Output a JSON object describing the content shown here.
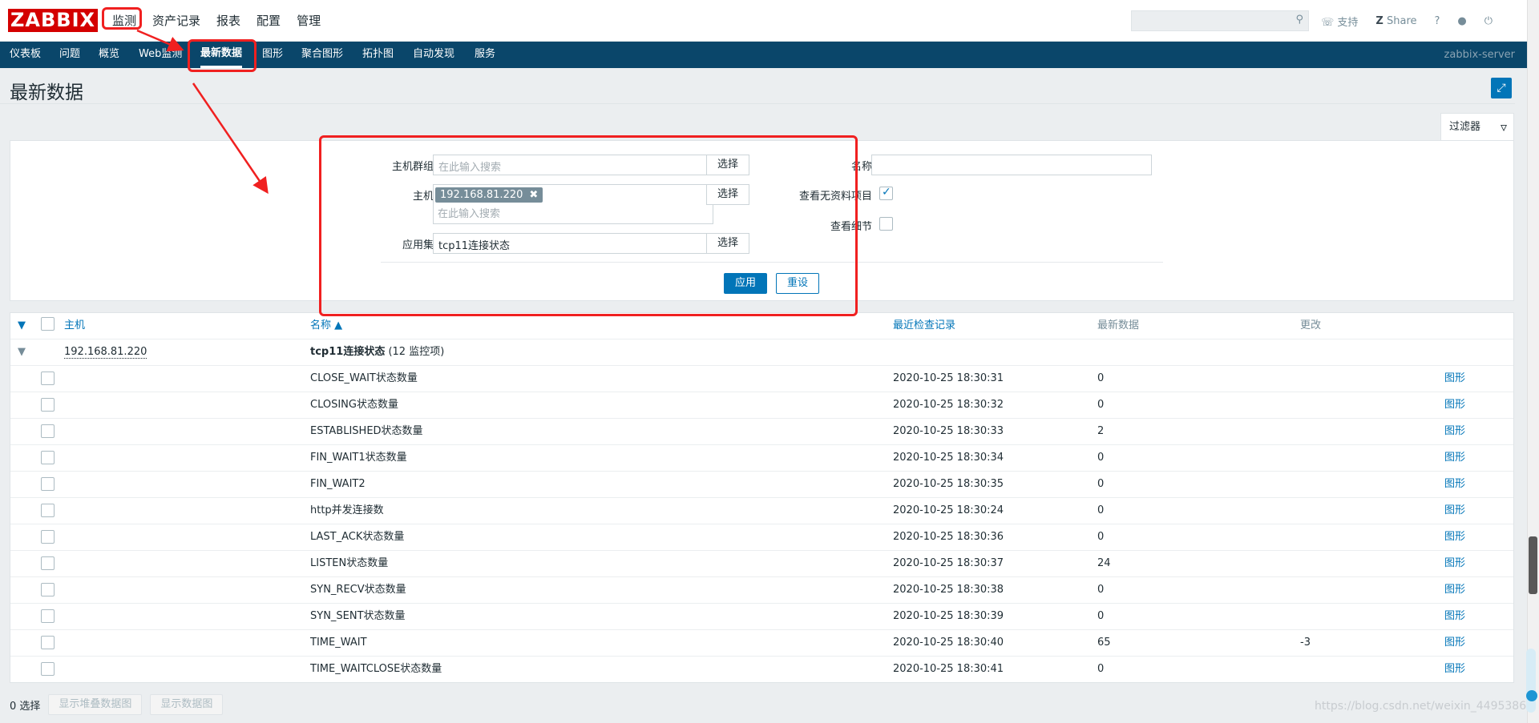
{
  "logo": "ZABBIX",
  "main_menu": [
    "监测",
    "资产记录",
    "报表",
    "配置",
    "管理"
  ],
  "search": {
    "placeholder": ""
  },
  "top_right": {
    "support": "支持",
    "share": "Share",
    "help": "?"
  },
  "sub_menu": [
    "仪表板",
    "问题",
    "概览",
    "Web监测",
    "最新数据",
    "图形",
    "聚合图形",
    "拓扑图",
    "自动发现",
    "服务"
  ],
  "sub_menu_active": "最新数据",
  "server_name": "zabbix-server",
  "page_title": "最新数据",
  "filter": {
    "tab_label": "过滤器",
    "host_groups_label": "主机群组",
    "host_groups_placeholder": "在此输入搜索",
    "hosts_label": "主机",
    "host_chip": "192.168.81.220",
    "hosts_placeholder": "在此输入搜索",
    "application_label": "应用集",
    "application_value": "tcp11连接状态",
    "select_label": "选择",
    "name_label": "名称",
    "name_value": "",
    "show_no_data_label": "查看无资料项目",
    "show_no_data_checked": true,
    "show_details_label": "查看细节",
    "show_details_checked": false,
    "apply_label": "应用",
    "reset_label": "重设"
  },
  "table": {
    "headers": {
      "host": "主机",
      "name": "名称 ▲",
      "last_check": "最近检查记录",
      "last_value": "最新数据",
      "change": "更改"
    },
    "group": {
      "host": "192.168.81.220",
      "app": "tcp11连接状态",
      "count": "(12 监控项)"
    },
    "graph_link": "图形",
    "rows": [
      {
        "name": "CLOSE_WAIT状态数量",
        "time": "2020-10-25 18:30:31",
        "value": "0",
        "change": ""
      },
      {
        "name": "CLOSING状态数量",
        "time": "2020-10-25 18:30:32",
        "value": "0",
        "change": ""
      },
      {
        "name": "ESTABLISHED状态数量",
        "time": "2020-10-25 18:30:33",
        "value": "2",
        "change": ""
      },
      {
        "name": "FIN_WAIT1状态数量",
        "time": "2020-10-25 18:30:34",
        "value": "0",
        "change": ""
      },
      {
        "name": "FIN_WAIT2",
        "time": "2020-10-25 18:30:35",
        "value": "0",
        "change": ""
      },
      {
        "name": "http并发连接数",
        "time": "2020-10-25 18:30:24",
        "value": "0",
        "change": ""
      },
      {
        "name": "LAST_ACK状态数量",
        "time": "2020-10-25 18:30:36",
        "value": "0",
        "change": ""
      },
      {
        "name": "LISTEN状态数量",
        "time": "2020-10-25 18:30:37",
        "value": "24",
        "change": ""
      },
      {
        "name": "SYN_RECV状态数量",
        "time": "2020-10-25 18:30:38",
        "value": "0",
        "change": ""
      },
      {
        "name": "SYN_SENT状态数量",
        "time": "2020-10-25 18:30:39",
        "value": "0",
        "change": ""
      },
      {
        "name": "TIME_WAIT",
        "time": "2020-10-25 18:30:40",
        "value": "65",
        "change": "-3"
      },
      {
        "name": "TIME_WAITCLOSE状态数量",
        "time": "2020-10-25 18:30:41",
        "value": "0",
        "change": ""
      }
    ]
  },
  "footer": {
    "selected": "0 选择",
    "stacked_graph": "显示堆叠数据图",
    "graph": "显示数据图"
  },
  "watermark": "https://blog.csdn.net/weixin_4495386",
  "colors": {
    "brand": "#d40000",
    "nav": "#0a466a",
    "accent": "#0275b8",
    "annotation": "#f02020"
  }
}
